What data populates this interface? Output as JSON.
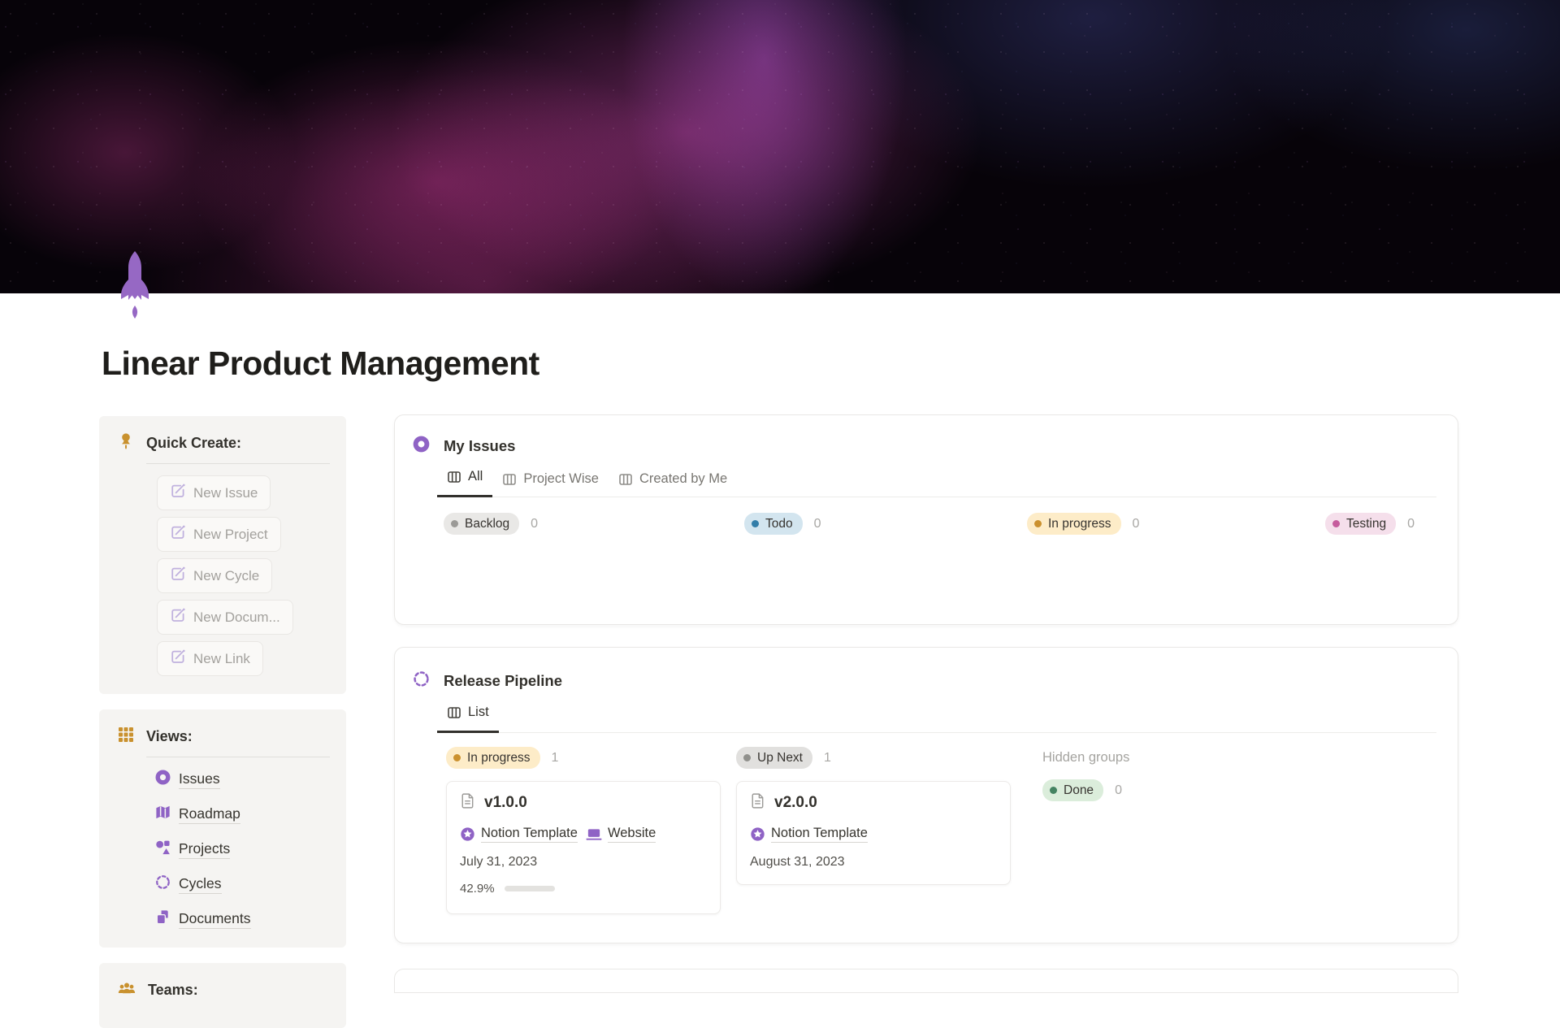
{
  "page": {
    "title": "Linear Product Management"
  },
  "sidebar": {
    "quick_create": {
      "title": "Quick Create:",
      "buttons": [
        {
          "label": "New Issue"
        },
        {
          "label": "New Project"
        },
        {
          "label": "New Cycle"
        },
        {
          "label": "New Docum..."
        },
        {
          "label": "New Link"
        }
      ]
    },
    "views": {
      "title": "Views:",
      "items": [
        {
          "label": "Issues",
          "icon": "donut-icon"
        },
        {
          "label": "Roadmap",
          "icon": "map-icon"
        },
        {
          "label": "Projects",
          "icon": "shapes-icon"
        },
        {
          "label": "Cycles",
          "icon": "dashed-circle-icon"
        },
        {
          "label": "Documents",
          "icon": "pages-icon"
        }
      ]
    },
    "teams": {
      "title": "Teams:"
    }
  },
  "my_issues": {
    "title": "My Issues",
    "tabs": [
      {
        "label": "All",
        "active": true
      },
      {
        "label": "Project Wise",
        "active": false
      },
      {
        "label": "Created by Me",
        "active": false
      }
    ],
    "groups": [
      {
        "label": "Backlog",
        "count": "0",
        "bg": "#e9e8e6",
        "dot": "#9b9a97"
      },
      {
        "label": "Todo",
        "count": "0",
        "bg": "#d3e5ef",
        "dot": "#337ea9"
      },
      {
        "label": "In progress",
        "count": "0",
        "bg": "#fdecc8",
        "dot": "#cb912f"
      },
      {
        "label": "Testing",
        "count": "0",
        "bg": "#f5dfeb",
        "dot": "#c65c9d"
      }
    ]
  },
  "release_pipeline": {
    "title": "Release Pipeline",
    "tabs": [
      {
        "label": "List",
        "active": true
      }
    ],
    "hidden_groups_label": "Hidden groups",
    "groups": [
      {
        "label": "In progress",
        "count": "1",
        "bg": "#fdecc8",
        "dot": "#cb912f"
      },
      {
        "label": "Up Next",
        "count": "1",
        "bg": "#e1e0de",
        "dot": "#90908c"
      },
      {
        "label": "Done",
        "count": "0",
        "bg": "#dbeddb",
        "dot": "#448361"
      }
    ],
    "cards": [
      {
        "title": "v1.0.0",
        "link1": "Notion Template",
        "link2": "Website",
        "date": "July 31, 2023",
        "progress_label": "42.9%",
        "progress_pct": 42.9
      },
      {
        "title": "v2.0.0",
        "link1": "Notion Template",
        "date": "August 31, 2023"
      }
    ]
  },
  "colors": {
    "accent_purple": "#8f63c5",
    "gold": "#c9912e",
    "progress_green": "#59895f",
    "banner_pink": "#d53e9e"
  }
}
